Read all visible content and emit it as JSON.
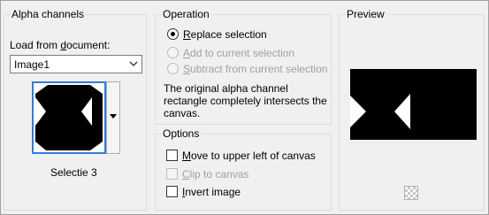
{
  "alpha_channels": {
    "title": "Alpha channels",
    "load_label_pre": "Load from ",
    "load_label_u": "d",
    "load_label_post": "ocument:",
    "document_value": "Image1",
    "channel_name": "Selectie 3"
  },
  "operation": {
    "title": "Operation",
    "options": [
      {
        "u": "R",
        "rest": "eplace selection",
        "selected": true,
        "enabled": true
      },
      {
        "u": "A",
        "rest": "dd to current selection",
        "selected": false,
        "enabled": false
      },
      {
        "u": "S",
        "rest": "ubtract from current selection",
        "selected": false,
        "enabled": false
      }
    ],
    "info_text": "The original alpha channel rectangle completely intersects the canvas."
  },
  "options": {
    "title": "Options",
    "items": [
      {
        "u": "M",
        "rest": "ove to upper left of canvas",
        "checked": false,
        "enabled": true
      },
      {
        "u": "C",
        "rest": "lip to canvas",
        "checked": false,
        "enabled": false
      },
      {
        "u": "I",
        "rest": "nvert image",
        "checked": false,
        "enabled": true
      }
    ]
  },
  "preview": {
    "title": "Preview",
    "icon": "transparency-checker-icon"
  },
  "colors": {
    "accent": "#2f7fd8",
    "shape_fill": "#000000",
    "background": "#f0f0f0"
  }
}
